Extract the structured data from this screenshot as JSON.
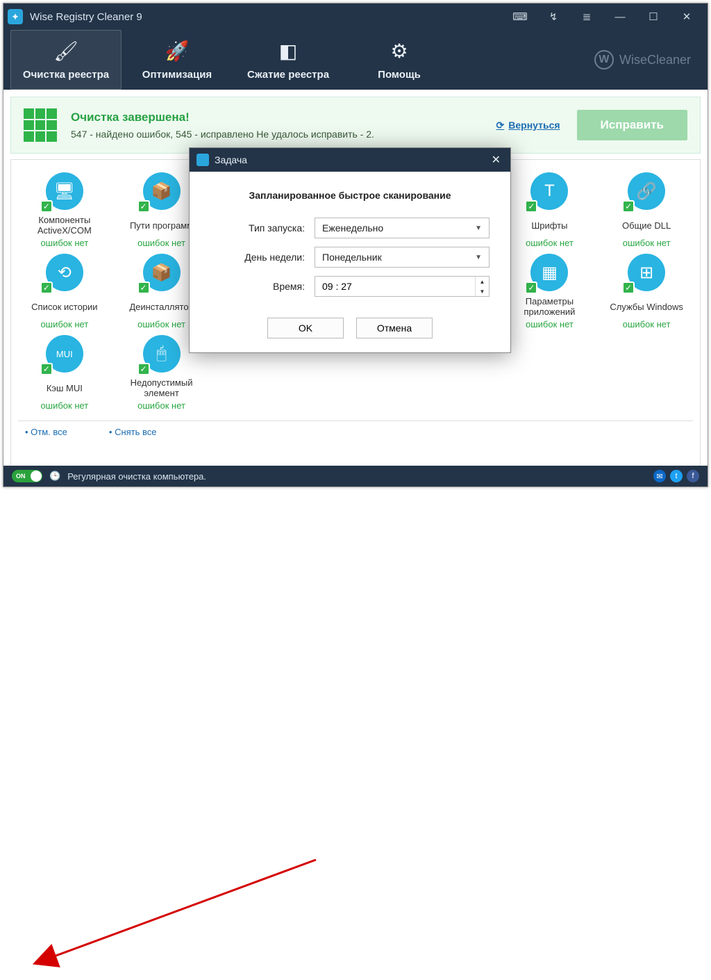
{
  "titlebar": {
    "app_title": "Wise Registry Cleaner 9"
  },
  "nav": {
    "tabs": [
      {
        "label": "Очистка реестра",
        "icon": "🖌"
      },
      {
        "label": "Оптимизация",
        "icon": "🚀"
      },
      {
        "label": "Сжатие реестра",
        "icon": "◧"
      },
      {
        "label": "Помощь",
        "icon": "⚙"
      }
    ],
    "brand": "WiseCleaner",
    "brand_initial": "W"
  },
  "status": {
    "heading": "Очистка завершена!",
    "subtext": "547 - найдено ошибок, 545 - исправлено Не удалось исправить - 2.",
    "return_label": "Вернуться",
    "fix_label": "Исправить"
  },
  "items": [
    {
      "label": "Компоненты ActiveX/COM",
      "status": "ошибок нет",
      "glyph": "🖥"
    },
    {
      "label": "Пути программ",
      "status": "ошибок нет",
      "glyph": "📦"
    },
    {
      "label": "",
      "status": "",
      "glyph": ""
    },
    {
      "label": "",
      "status": "",
      "glyph": ""
    },
    {
      "label": "",
      "status": "",
      "glyph": ""
    },
    {
      "label": "Шрифты",
      "status": "ошибок нет",
      "glyph": "T"
    },
    {
      "label": "Общие DLL",
      "status": "ошибок нет",
      "glyph": "🔗"
    },
    {
      "label": "Список истории",
      "status": "ошибок нет",
      "glyph": "⟲"
    },
    {
      "label": "Деинсталлятор",
      "status": "ошибок нет",
      "glyph": "📦"
    },
    {
      "label": "",
      "status": "",
      "glyph": ""
    },
    {
      "label": "",
      "status": "",
      "glyph": ""
    },
    {
      "label": "",
      "status": "",
      "glyph": ""
    },
    {
      "label": "Параметры приложений",
      "status": "ошибок нет",
      "glyph": "▦"
    },
    {
      "label": "Службы Windows",
      "status": "ошибок нет",
      "glyph": "⊞"
    },
    {
      "label": "Кэш MUI",
      "status": "ошибок нет",
      "glyph": "MUI"
    },
    {
      "label": "Недопустимый элемент",
      "status": "ошибок нет",
      "glyph": "🖱"
    }
  ],
  "bottom_links": {
    "select_all": "Отм. все",
    "deselect_all": "Снять все"
  },
  "footer": {
    "toggle_label": "ON",
    "text": "Регулярная очистка компьютера."
  },
  "modal": {
    "title": "Задача",
    "heading": "Запланированное быстрое сканирование",
    "row_type_label": "Тип запуска:",
    "row_type_value": "Еженедельно",
    "row_day_label": "День недели:",
    "row_day_value": "Понедельник",
    "row_time_label": "Время:",
    "row_time_value": "09 : 27",
    "ok_label": "OK",
    "cancel_label": "Отмена"
  }
}
